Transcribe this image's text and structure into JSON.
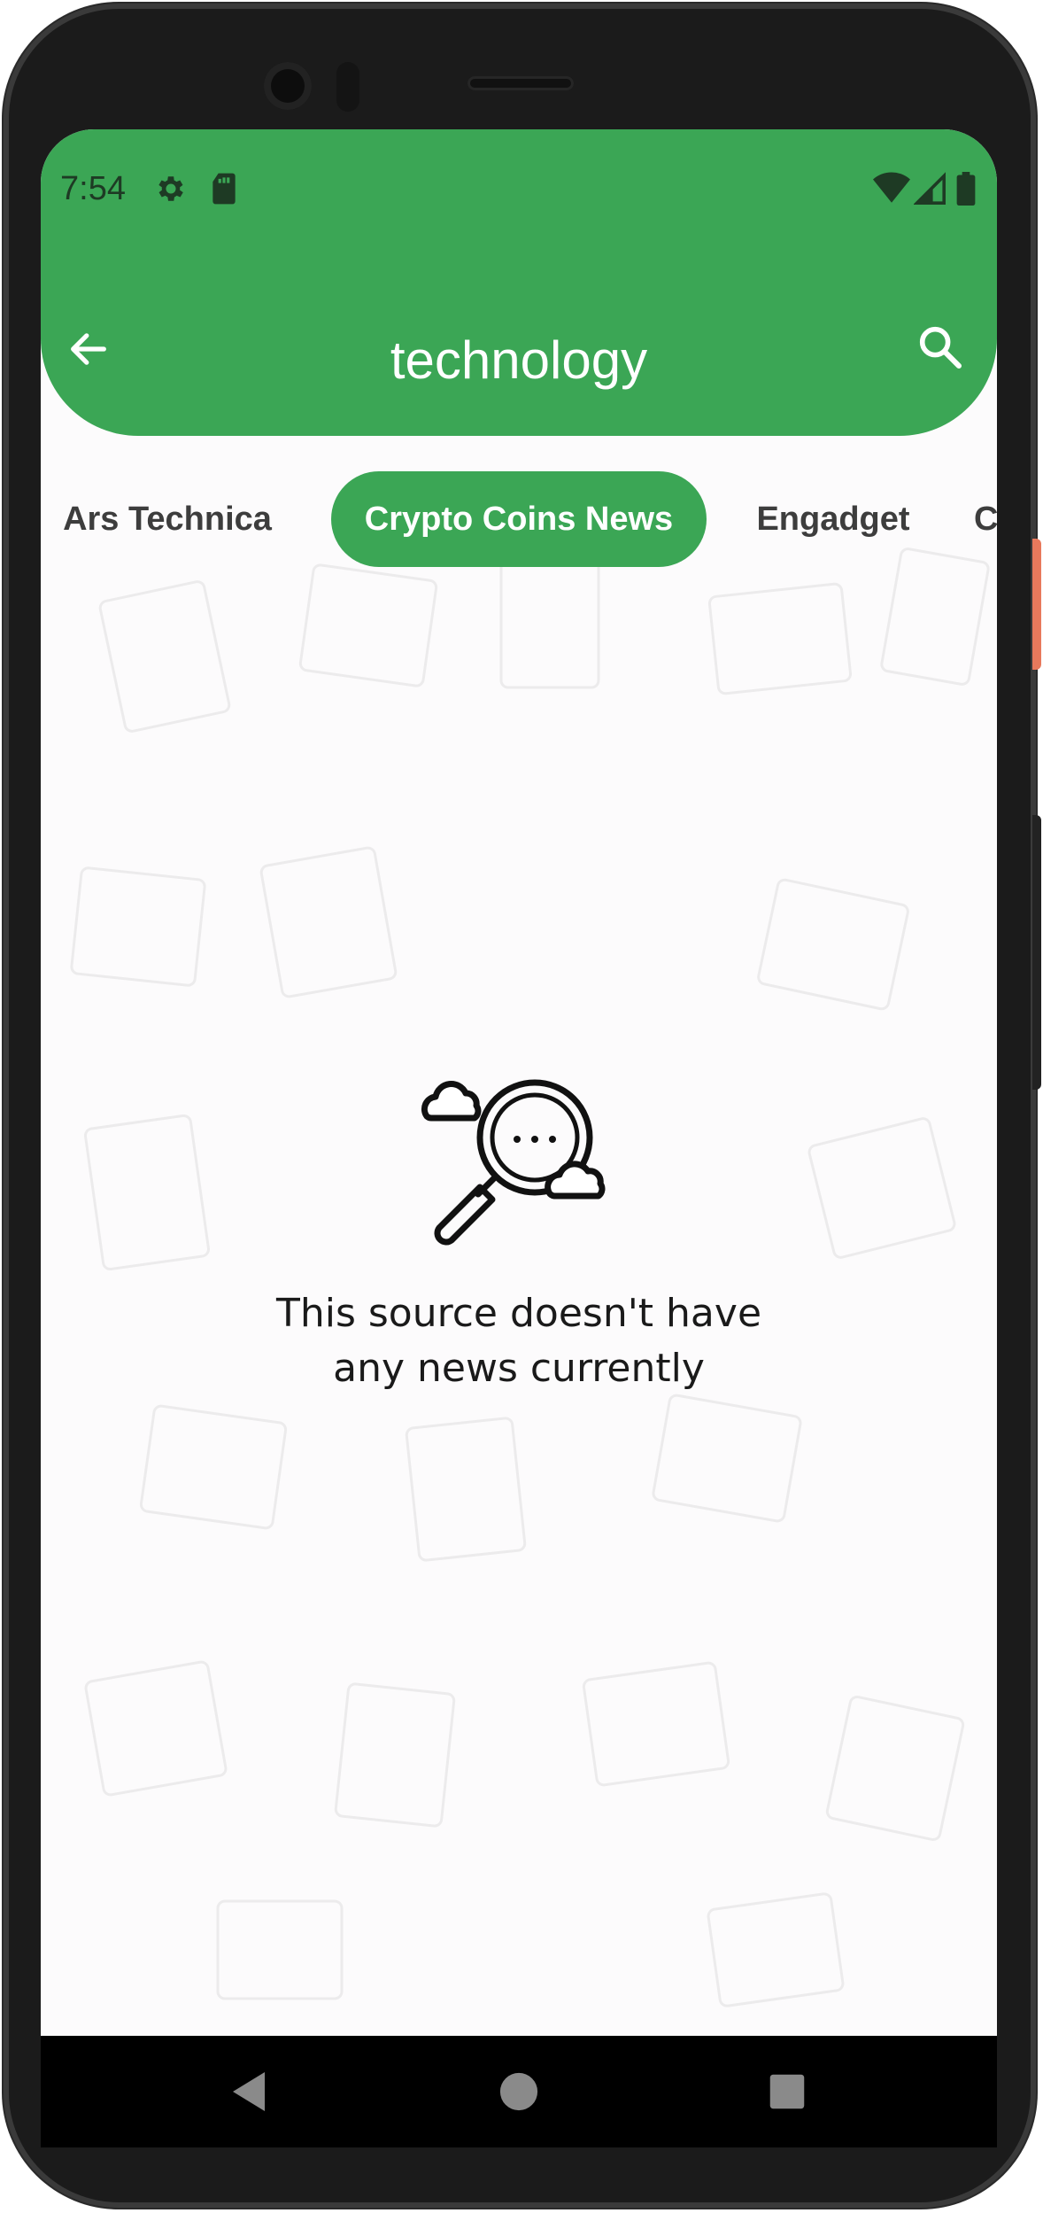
{
  "status_bar": {
    "time": "7:54",
    "icons": [
      "settings-icon",
      "sd-card-icon",
      "wifi-icon",
      "cellular-icon",
      "battery-icon"
    ]
  },
  "app_bar": {
    "title": "technology",
    "back_icon": "arrow-left-icon",
    "search_icon": "search-icon",
    "color": "#3ba655"
  },
  "tabs": [
    {
      "label": "Ars Technica",
      "active": false
    },
    {
      "label": "Crypto Coins News",
      "active": true
    },
    {
      "label": "Engadget",
      "active": false
    },
    {
      "label": "C",
      "active": false
    }
  ],
  "empty_state": {
    "icon": "search-clouds-icon",
    "message_line1": "This source doesn't have",
    "message_line2": "any news currently"
  },
  "nav_bar": {
    "back_icon": "triangle-back-icon",
    "home_icon": "circle-home-icon",
    "recents_icon": "square-recents-icon"
  }
}
